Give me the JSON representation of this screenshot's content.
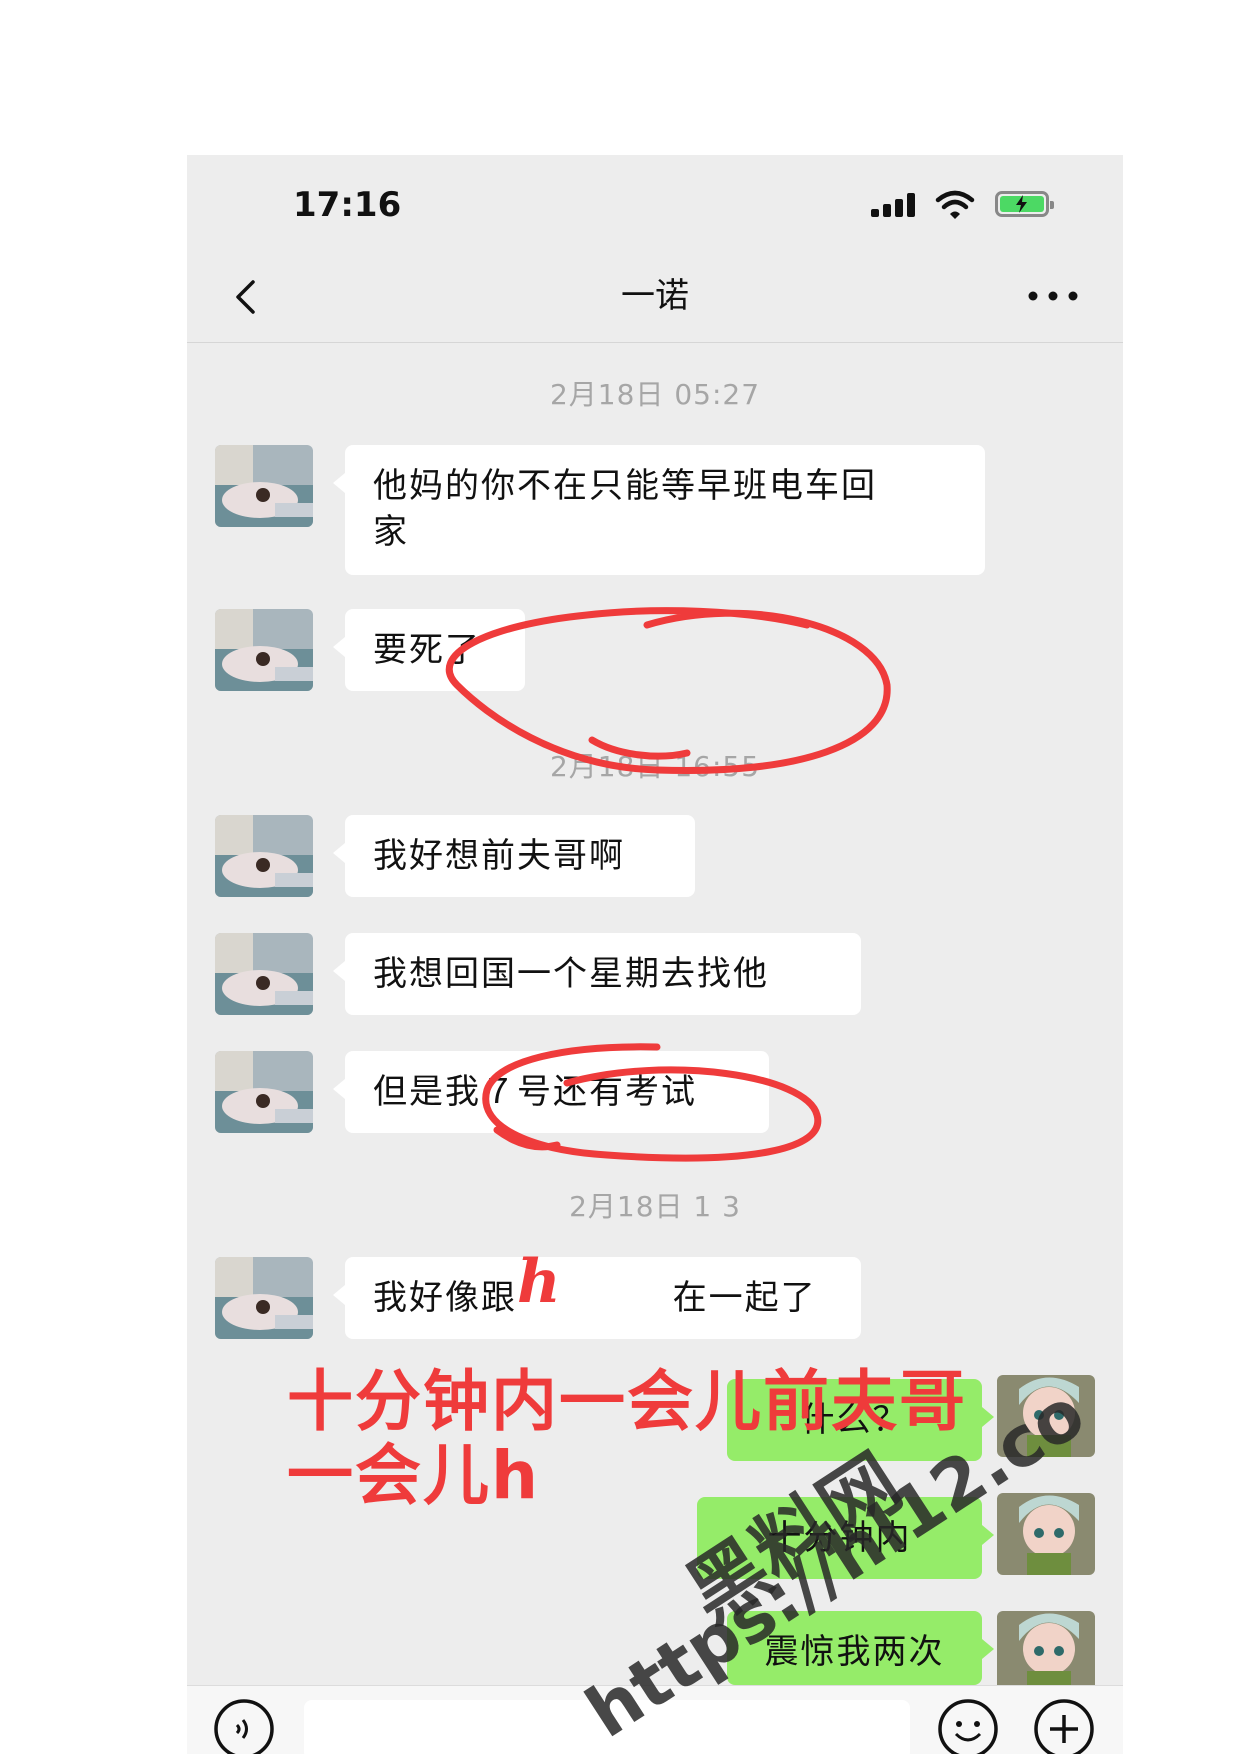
{
  "status_bar": {
    "time": "17:16"
  },
  "header": {
    "title": "一诺"
  },
  "timestamps": [
    "2月18日 05:27",
    "2月18日 16:55",
    "2月18日 1   3"
  ],
  "messages": [
    {
      "side": "left",
      "text_line1": "他妈的你不在只能等早班电车回",
      "text_line2": "家"
    },
    {
      "side": "left",
      "text": "要死了"
    },
    {
      "side": "left",
      "text": "我好想前夫哥啊"
    },
    {
      "side": "left",
      "text": "我想回国一个星期去找他"
    },
    {
      "side": "left",
      "text": "但是我７号还有考试"
    },
    {
      "side": "left",
      "text": "我好像跟"
    },
    {
      "side": "left",
      "text_tail": "在一起了"
    },
    {
      "side": "right",
      "text": "什么？"
    },
    {
      "side": "right",
      "text": "十分钟内"
    },
    {
      "side": "right",
      "text": "震惊我两次"
    }
  ],
  "annotation": {
    "line1": "十分钟内一会儿前夫哥",
    "line2": "一会儿h",
    "mark": "h"
  },
  "watermark": {
    "name": "黑料网",
    "url": "https://hl12.co"
  },
  "colors": {
    "annotation_red": "#ef3b3b",
    "bubble_green": "#95ec69",
    "battery_green": "#4cd964"
  }
}
